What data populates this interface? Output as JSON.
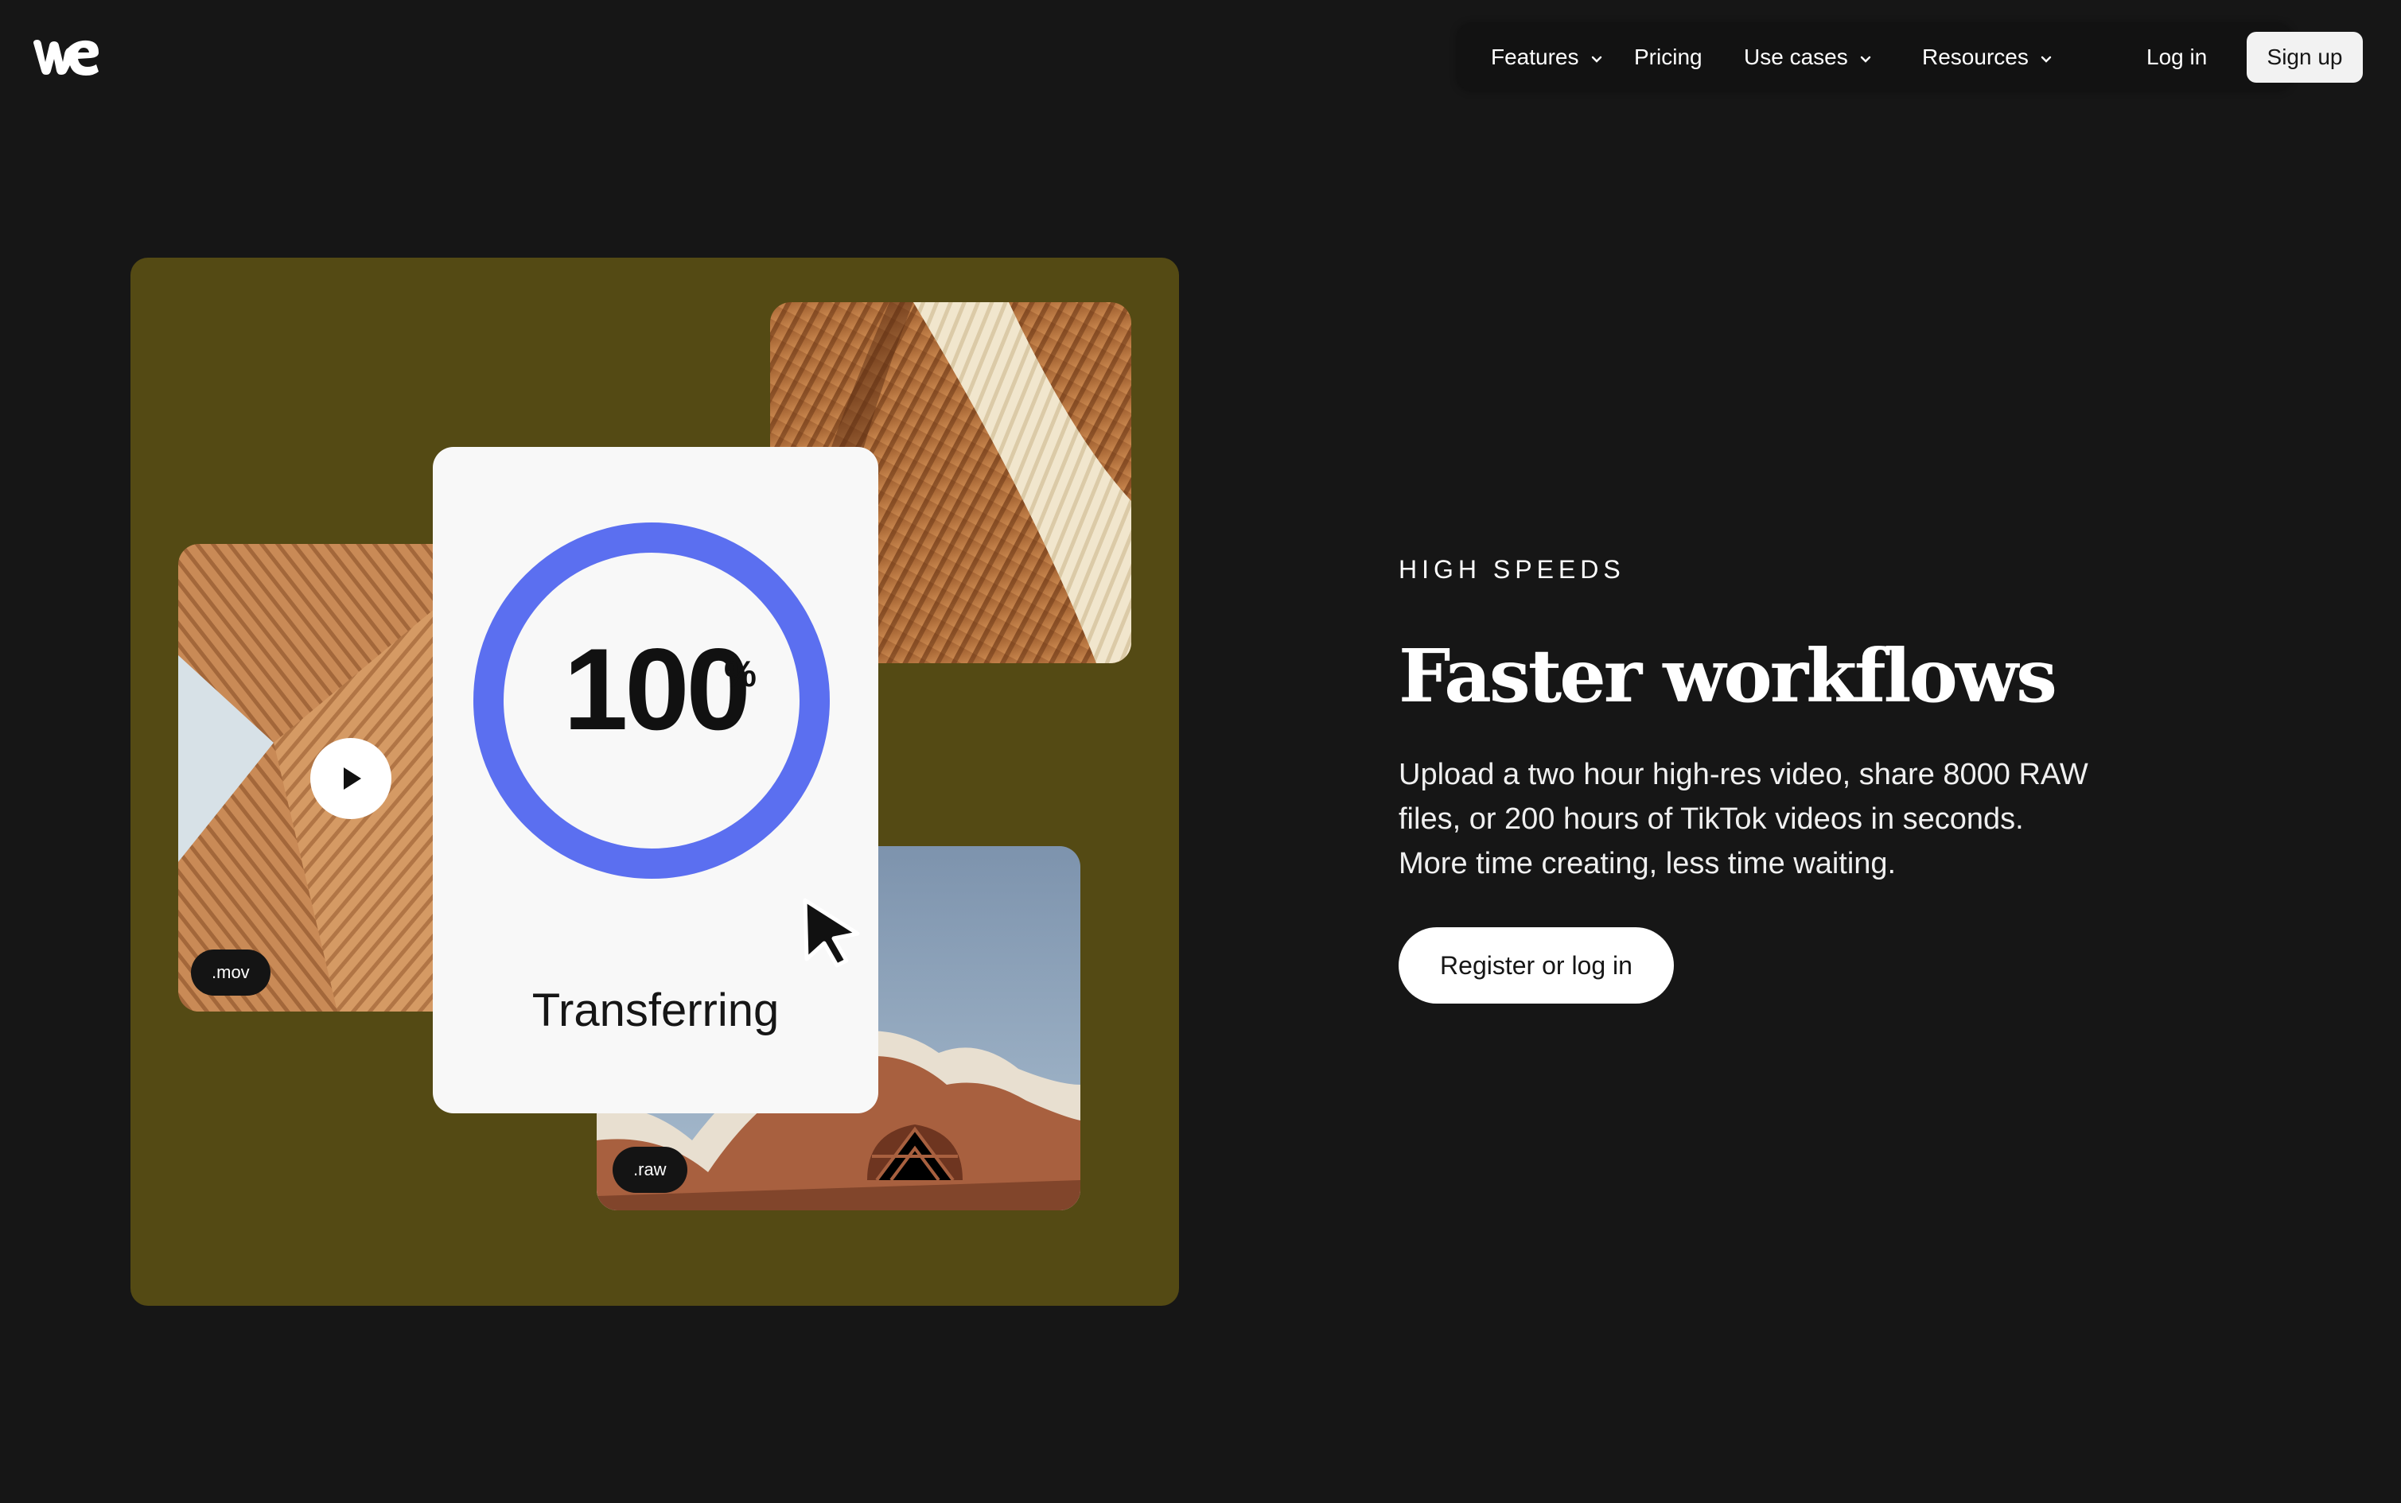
{
  "header": {
    "logo_name": "we-logo",
    "nav": [
      {
        "label": "Features",
        "has_dropdown": true
      },
      {
        "label": "Pricing",
        "has_dropdown": false
      },
      {
        "label": "Use cases",
        "has_dropdown": true
      },
      {
        "label": "Resources",
        "has_dropdown": true
      }
    ],
    "login_label": "Log in",
    "signup_label": "Sign up"
  },
  "illustration": {
    "background_color": "#544a14",
    "tag_mov": ".mov",
    "tag_raw": ".raw",
    "progress_value": "100",
    "progress_unit": "%",
    "progress_fraction": 1.0,
    "progress_label": "Transferring",
    "ring_color": "#5b6ff0"
  },
  "hero": {
    "eyebrow": "HIGH SPEEDS",
    "title": "Faster workflows",
    "body": "Upload a two hour high-res video, share 8000 RAW files, or 200 hours of TikTok videos in seconds. More time creating, less time waiting.",
    "cta_label": "Register or log in"
  }
}
